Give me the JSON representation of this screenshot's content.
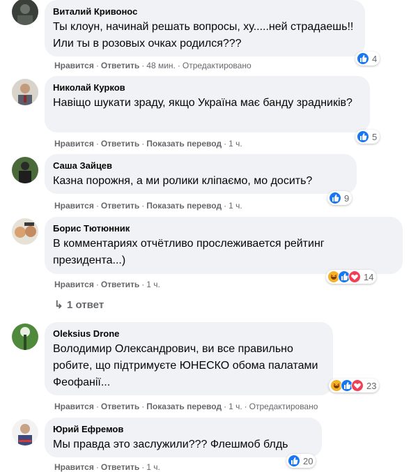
{
  "comments": [
    {
      "author": "Виталий Кривонос",
      "text": "Ты клоун, начинай решать вопросы, ху.....ней страдаешь!! Или ты в розовых очках родился???",
      "like": "Нравится",
      "reply": "Ответить",
      "time": "48 мин.",
      "extra": "Отредактировано",
      "reaction_count": "4"
    },
    {
      "author": "Николай Курков",
      "text": "Навіщо шукати зраду, якщо Україна має банду зрадників?",
      "like": "Нравится",
      "reply": "Ответить",
      "translate": "Показать перевод",
      "time": "1 ч.",
      "reaction_count": "5"
    },
    {
      "author": "Саша Зайцев",
      "text": "Казна порожня, а ми ролики кліпаємо, мо досить?",
      "like": "Нравится",
      "reply": "Ответить",
      "translate": "Показать перевод",
      "time": "1 ч.",
      "reaction_count": "9"
    },
    {
      "author": "Борис Тютюнник",
      "text": "В комментариях отчётливо прослеживается рейтинг президента...)",
      "like": "Нравится",
      "reply": "Ответить",
      "time": "1 ч.",
      "reaction_count": "14",
      "replies": "1 ответ"
    },
    {
      "author": "Oleksius Drone",
      "text": "Володимир Олександрович, ви все правильно робите, що підтримуєте ЮНЕСКО обома палатами Феофанії...",
      "like": "Нравится",
      "reply": "Ответить",
      "translate": "Показать перевод",
      "time": "1 ч.",
      "extra": "Отредактировано",
      "reaction_count": "23"
    },
    {
      "author": "Юрий Ефремов",
      "text": "Мы правда это заслужили??? Флешмоб блдь",
      "like": "Нравится",
      "reply": "Ответить",
      "time": "1 ч.",
      "reaction_count": "20"
    }
  ],
  "colors": {
    "like": "#1877f2",
    "haha": "#f7b125",
    "love": "#f33e58",
    "bubble": "#f0f2f5",
    "meta": "#65676b"
  }
}
